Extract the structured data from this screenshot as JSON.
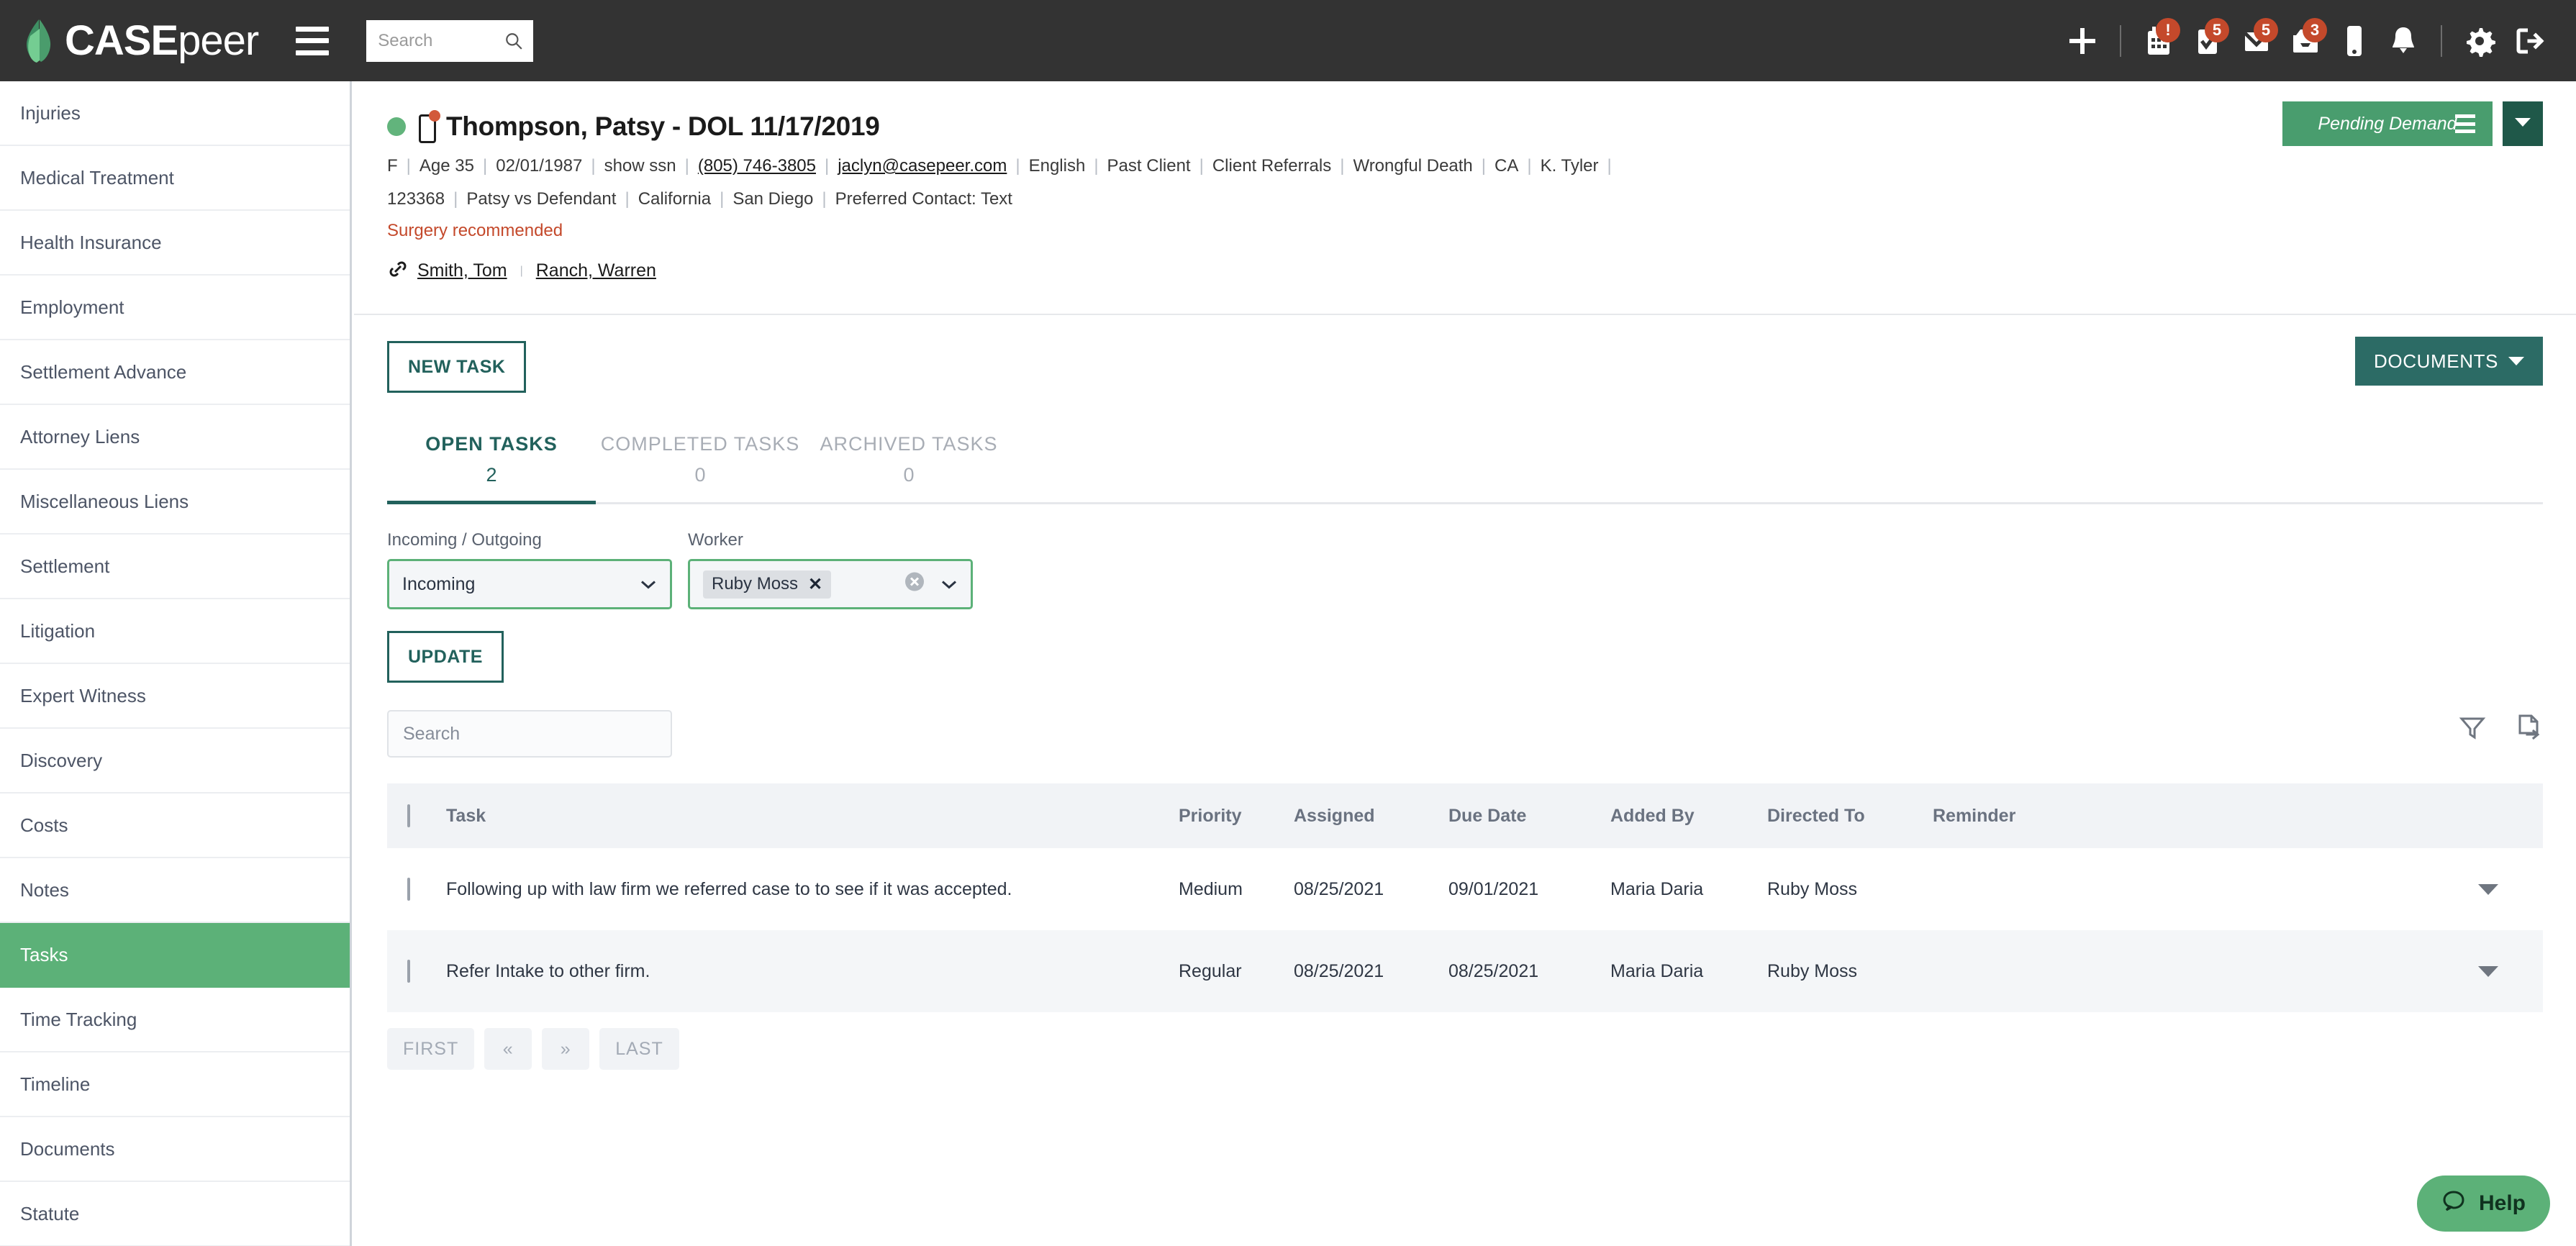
{
  "brand": {
    "name_case": "CASE",
    "name_peer": "peer",
    "logo_icon": "leaf-logo-icon",
    "green": "#5cb178",
    "teal": "#22615c",
    "dark": "#333333",
    "accent_red": "#c4492b"
  },
  "topbar": {
    "menu_icon": "hamburger-menu-icon",
    "search": {
      "value": "",
      "placeholder": "Search",
      "icon": "search-icon"
    },
    "icons": [
      {
        "name": "plus-icon",
        "badge": ""
      },
      {
        "name": "calendar-icon",
        "badge": "!"
      },
      {
        "name": "task-check-icon",
        "badge": "5"
      },
      {
        "name": "envelope-icon",
        "badge": "5"
      },
      {
        "name": "inbox-icon",
        "badge": "3"
      },
      {
        "name": "mobile-phone-icon",
        "badge": ""
      },
      {
        "name": "bell-icon",
        "badge": ""
      },
      {
        "name": "gear-icon",
        "badge": ""
      },
      {
        "name": "logout-icon",
        "badge": ""
      }
    ]
  },
  "sidebar": {
    "items": [
      {
        "label": "Injuries",
        "active": false
      },
      {
        "label": "Medical Treatment",
        "active": false
      },
      {
        "label": "Health Insurance",
        "active": false
      },
      {
        "label": "Employment",
        "active": false
      },
      {
        "label": "Settlement Advance",
        "active": false
      },
      {
        "label": "Attorney Liens",
        "active": false
      },
      {
        "label": "Miscellaneous Liens",
        "active": false
      },
      {
        "label": "Settlement",
        "active": false
      },
      {
        "label": "Litigation",
        "active": false
      },
      {
        "label": "Expert Witness",
        "active": false
      },
      {
        "label": "Discovery",
        "active": false
      },
      {
        "label": "Costs",
        "active": false
      },
      {
        "label": "Notes",
        "active": false
      },
      {
        "label": "Tasks",
        "active": true
      },
      {
        "label": "Time Tracking",
        "active": false
      },
      {
        "label": "Timeline",
        "active": false
      },
      {
        "label": "Documents",
        "active": false
      },
      {
        "label": "Statute",
        "active": false
      }
    ]
  },
  "case": {
    "status_dot_color": "#62b47c",
    "phone_icon": "mobile-phone-icon",
    "title": "Thompson, Patsy - DOL 11/17/2019",
    "meta_line1": [
      "F",
      "Age 35",
      "02/01/1987",
      "show ssn",
      "(805) 746-3805",
      "jaclyn@casepeer.com",
      "English",
      "Past Client",
      "Client Referrals",
      "Wrongful Death",
      "CA",
      "K. Tyler",
      ""
    ],
    "meta_line1_links": [
      "(805) 746-3805",
      "jaclyn@casepeer.com"
    ],
    "meta_line2": [
      "123368",
      "Patsy vs Defendant",
      "California",
      "San Diego",
      "Preferred Contact: Text"
    ],
    "alert": "Surgery recommended",
    "linked_icon": "link-chain-icon",
    "linked_contacts": [
      "Smith, Tom",
      "Ranch, Warren"
    ],
    "status_button": {
      "label": "Pending Demand",
      "menu_icon": "hamburger-menu-icon",
      "caret_icon": "chevron-down-icon"
    }
  },
  "toolbar": {
    "new_task_label": "NEW TASK",
    "documents_label": "DOCUMENTS",
    "documents_caret_icon": "chevron-down-icon"
  },
  "tabs": [
    {
      "label": "OPEN TASKS",
      "count": "2",
      "active": true
    },
    {
      "label": "COMPLETED TASKS",
      "count": "0",
      "active": false
    },
    {
      "label": "ARCHIVED TASKS",
      "count": "0",
      "active": false
    }
  ],
  "filters": {
    "incoming_outgoing": {
      "label": "Incoming / Outgoing",
      "value": "Incoming",
      "chevron_icon": "chevron-down-icon"
    },
    "worker": {
      "label": "Worker",
      "chips": [
        "Ruby Moss"
      ],
      "chip_remove_icon": "close-x-icon",
      "clear_icon": "clear-circle-icon",
      "chevron_icon": "chevron-down-icon"
    },
    "update_label": "UPDATE"
  },
  "table_toolbar": {
    "search": {
      "value": "",
      "placeholder": "Search",
      "icon": "search-icon"
    },
    "filter_icon": "funnel-filter-icon",
    "export_icon": "file-export-icon"
  },
  "table": {
    "columns": [
      "",
      "Task",
      "Priority",
      "Assigned",
      "Due Date",
      "Added By",
      "Directed To",
      "Reminder",
      ""
    ],
    "rows": [
      {
        "task": "Following up with law firm we referred case to to see if it was accepted.",
        "priority": "Medium",
        "assigned": "08/25/2021",
        "due_date": "09/01/2021",
        "added_by": "Maria Daria",
        "directed_to": "Ruby Moss",
        "reminder": "",
        "row_menu_icon": "chevron-down-icon"
      },
      {
        "task": "Refer Intake to other firm.",
        "priority": "Regular",
        "assigned": "08/25/2021",
        "due_date": "08/25/2021",
        "added_by": "Maria Daria",
        "directed_to": "Ruby Moss",
        "reminder": "",
        "row_menu_icon": "chevron-down-icon"
      }
    ]
  },
  "pagination": {
    "first": "FIRST",
    "prev": "«",
    "next": "»",
    "last": "LAST"
  },
  "help": {
    "label": "Help",
    "icon": "chat-bubble-icon"
  }
}
